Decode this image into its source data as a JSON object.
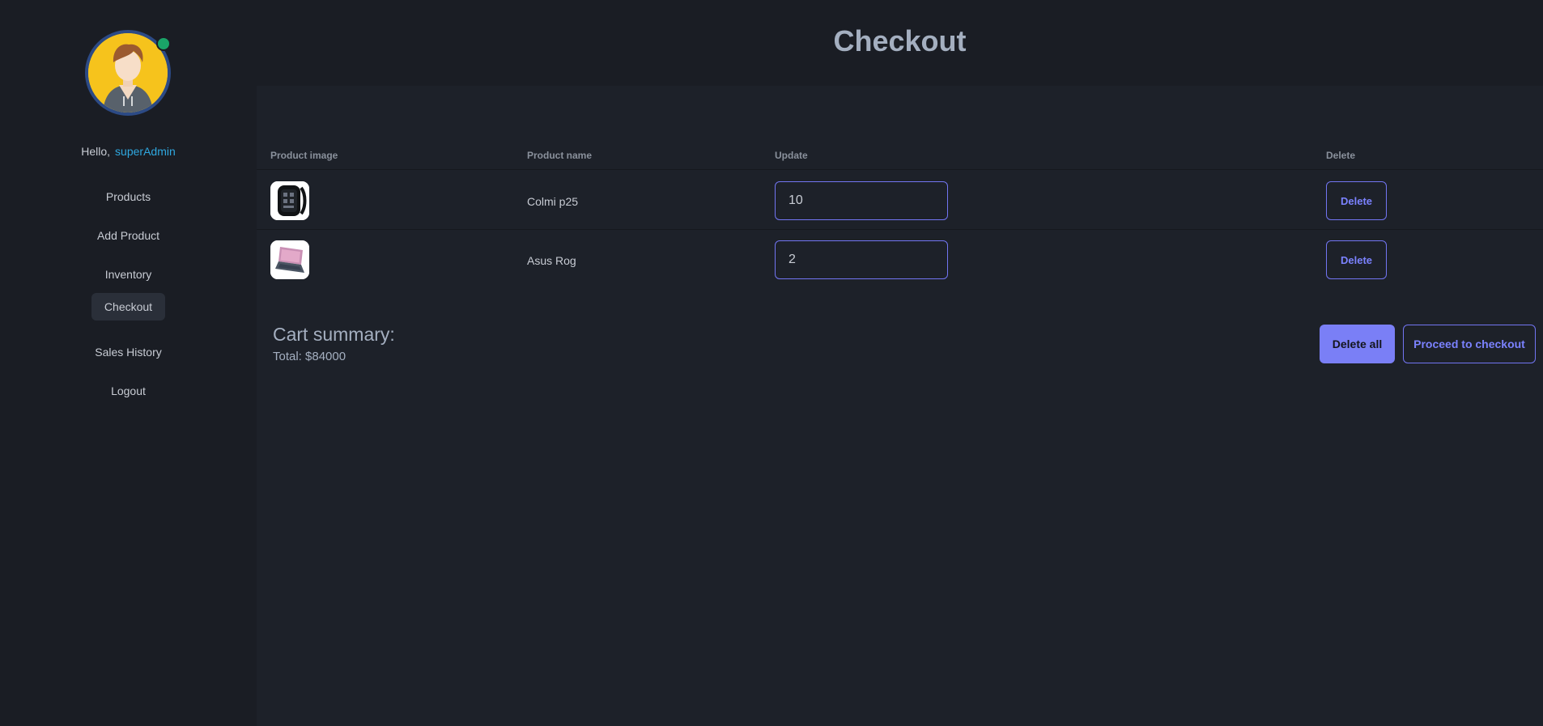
{
  "sidebar": {
    "greeting": "Hello,",
    "username": "superAdmin",
    "items": [
      {
        "label": "Products"
      },
      {
        "label": "Add Product"
      },
      {
        "label": "Inventory"
      },
      {
        "label": "Checkout"
      },
      {
        "label": "Sales History"
      },
      {
        "label": "Logout"
      }
    ],
    "active_item": "Checkout"
  },
  "header": {
    "title": "Checkout"
  },
  "table": {
    "columns": [
      "Product image",
      "Product name",
      "Update",
      "Delete"
    ],
    "rows": [
      {
        "image_icon": "smartwatch-image",
        "name": "Colmi p25",
        "quantity": "10",
        "delete_label": "Delete"
      },
      {
        "image_icon": "laptop-image",
        "name": "Asus Rog",
        "quantity": "2",
        "delete_label": "Delete"
      }
    ]
  },
  "summary": {
    "title": "Cart summary:",
    "total": "Total: $84000",
    "delete_all_label": "Delete all",
    "proceed_label": "Proceed to checkout"
  },
  "colors": {
    "accent": "#7275f2",
    "username": "#2fa8e0",
    "online_status": "#1aa468",
    "avatar_bg": "#f6c31c"
  }
}
